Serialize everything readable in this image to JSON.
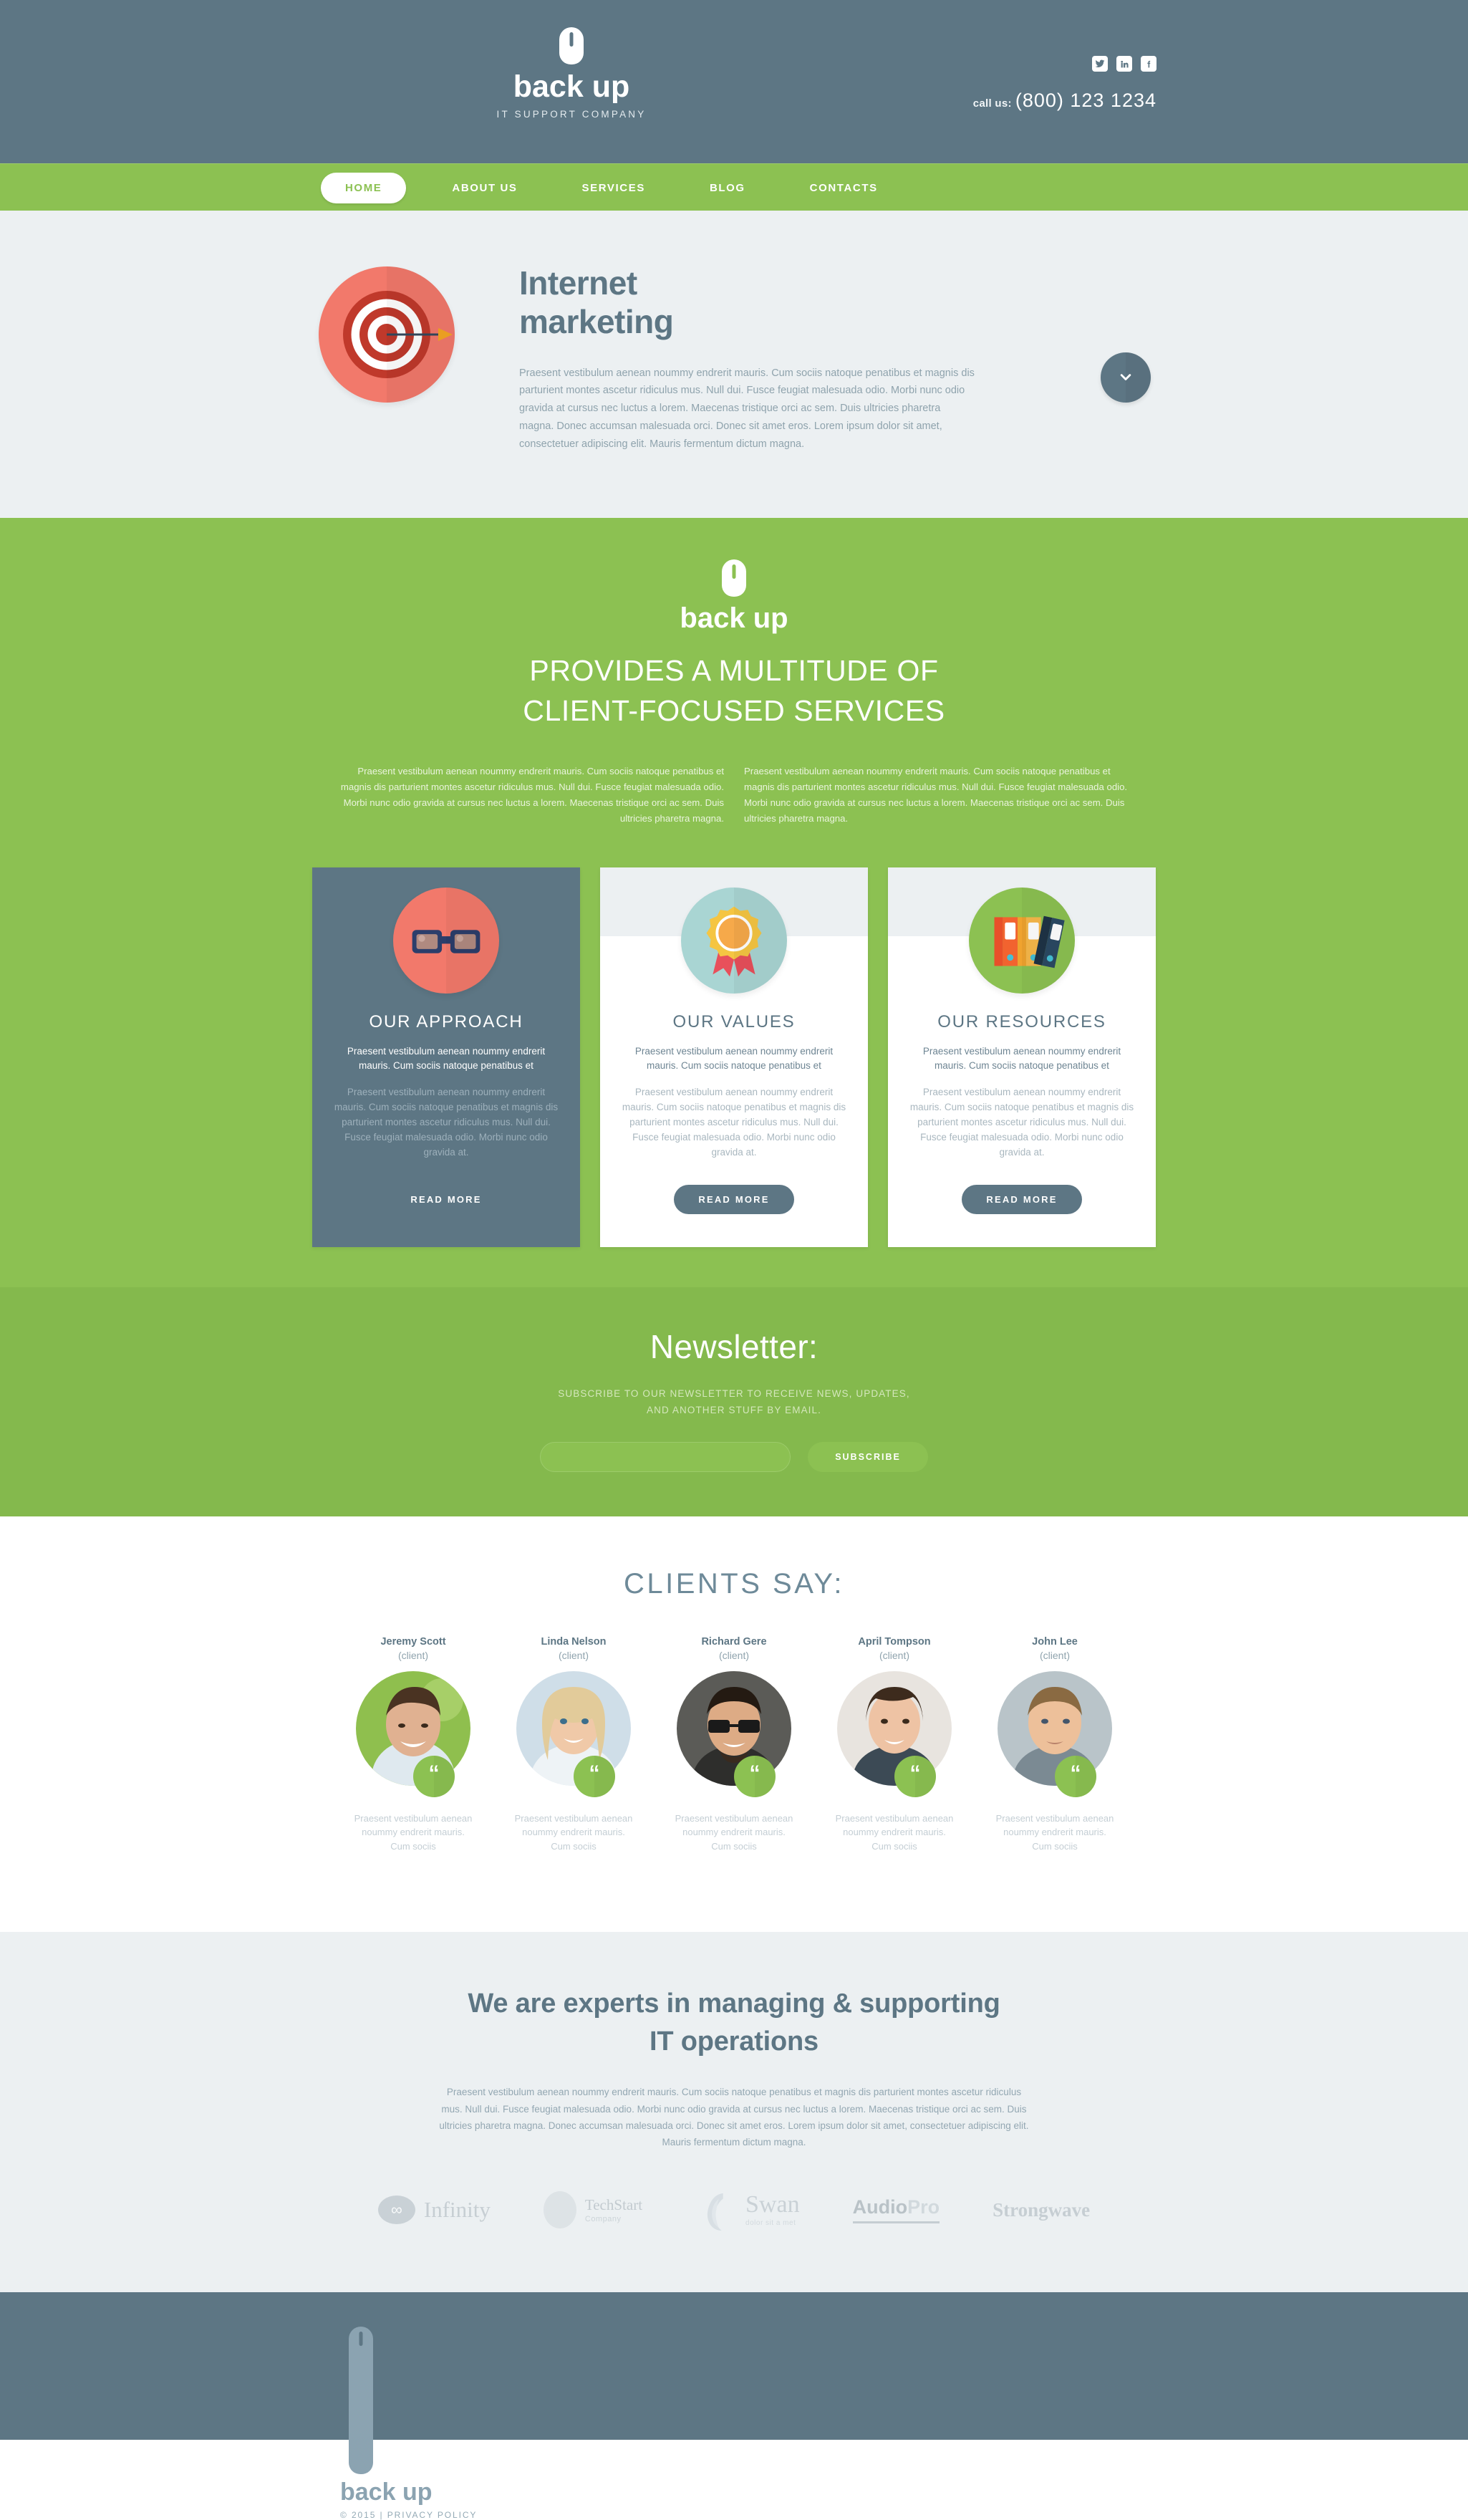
{
  "header": {
    "logo_name": "back up",
    "logo_tagline": "IT SUPPORT COMPANY",
    "socials": [
      {
        "name": "twitter-icon",
        "label": "Twitter"
      },
      {
        "name": "linkedin-icon",
        "label": "LinkedIn"
      },
      {
        "name": "facebook-icon",
        "label": "Facebook"
      }
    ],
    "call_label": "call us:",
    "phone": "(800) 123 1234"
  },
  "nav": {
    "items": [
      {
        "label": "HOME",
        "active": true
      },
      {
        "label": "ABOUT US",
        "active": false
      },
      {
        "label": "SERVICES",
        "active": false
      },
      {
        "label": "BLOG",
        "active": false
      },
      {
        "label": "CONTACTS",
        "active": false
      }
    ]
  },
  "hero": {
    "icon": "target-with-arrow-icon",
    "title_line1": "Internet",
    "title_line2": "marketing",
    "paragraph": "Praesent vestibulum aenean noummy endrerit mauris. Cum sociis natoque penatibus et magnis dis parturient montes ascetur ridiculus mus. Null dui. Fusce feugiat malesuada odio. Morbi nunc odio gravida at cursus nec luctus a lorem. Maecenas tristique orci ac sem. Duis ultricies pharetra magna. Donec accumsan malesuada orci. Donec sit amet eros. Lorem ipsum dolor sit amet, consectetuer adipiscing elit. Mauris fermentum dictum magna.",
    "scroll_icon": "chevron-down-icon"
  },
  "services": {
    "brand_name": "back up",
    "heading_line1": "PROVIDES A MULTITUDE OF",
    "heading_line2": "CLIENT-FOCUSED SERVICES",
    "intro_left": "Praesent vestibulum aenean noummy endrerit mauris. Cum sociis natoque penatibus et magnis dis parturient montes ascetur ridiculus mus. Null dui. Fusce feugiat malesuada odio. Morbi nunc odio gravida at cursus nec luctus a lorem. Maecenas tristique orci ac sem. Duis ultricies pharetra magna.",
    "intro_right": "Praesent vestibulum aenean noummy endrerit mauris. Cum sociis natoque penatibus et magnis dis parturient montes ascetur ridiculus mus. Null dui. Fusce feugiat malesuada odio. Morbi nunc odio gravida at cursus nec luctus a lorem. Maecenas tristique orci ac sem. Duis ultricies pharetra magna.",
    "cards": [
      {
        "icon": "glasses-icon",
        "icon_color": "#f2796b",
        "title": "OUR APPROACH",
        "lead": "Praesent vestibulum aenean noummy endrerit mauris. Cum sociis natoque penatibus et",
        "desc": "Praesent vestibulum aenean noummy endrerit mauris. Cum sociis natoque penatibus et magnis dis parturient montes ascetur ridiculus mus. Null dui. Fusce feugiat malesuada odio. Morbi nunc odio gravida at.",
        "button": "READ MORE"
      },
      {
        "icon": "award-medal-icon",
        "icon_color": "#a9d5d3",
        "title": "OUR VALUES",
        "lead": "Praesent vestibulum aenean noummy endrerit mauris. Cum sociis natoque penatibus et",
        "desc": "Praesent vestibulum aenean noummy endrerit mauris. Cum sociis natoque penatibus et magnis dis parturient montes ascetur ridiculus mus. Null dui. Fusce feugiat malesuada odio. Morbi nunc odio gravida at.",
        "button": "READ MORE"
      },
      {
        "icon": "binders-icon",
        "icon_color": "#8cc152",
        "title": "OUR RESOURCES",
        "lead": "Praesent vestibulum aenean noummy endrerit mauris. Cum sociis natoque penatibus et",
        "desc": "Praesent vestibulum aenean noummy endrerit mauris. Cum sociis natoque penatibus et magnis dis parturient montes ascetur ridiculus mus. Null dui. Fusce feugiat malesuada odio. Morbi nunc odio gravida at.",
        "button": "READ MORE"
      }
    ]
  },
  "newsletter": {
    "title": "Newsletter:",
    "subtitle_line1": "SUBSCRIBE TO OUR NEWSLETTER TO RECEIVE NEWS, UPDATES,",
    "subtitle_line2": "AND ANOTHER STUFF BY EMAIL.",
    "input_value": "",
    "input_placeholder": "",
    "button": "SUBSCRIBE"
  },
  "clients": {
    "title": "CLIENTS SAY:",
    "quote_glyph": "“",
    "items": [
      {
        "name": "Jeremy Scott",
        "role": "(client)",
        "text": "Praesent vestibulum aenean noummy endrerit mauris. Cum sociis"
      },
      {
        "name": "Linda Nelson",
        "role": "(client)",
        "text": "Praesent vestibulum aenean noummy endrerit mauris. Cum sociis"
      },
      {
        "name": "Richard Gere",
        "role": "(client)",
        "text": "Praesent vestibulum aenean noummy endrerit mauris. Cum sociis"
      },
      {
        "name": "April Tompson",
        "role": "(client)",
        "text": "Praesent vestibulum aenean noummy endrerit mauris. Cum sociis"
      },
      {
        "name": "John Lee",
        "role": "(client)",
        "text": "Praesent vestibulum aenean noummy endrerit mauris. Cum sociis"
      }
    ]
  },
  "experts": {
    "title_line1": "We are experts in managing & supporting",
    "title_line2": "IT operations",
    "paragraph": "Praesent vestibulum aenean noummy endrerit mauris. Cum sociis natoque penatibus et magnis dis parturient montes ascetur ridiculus mus. Null dui. Fusce feugiat malesuada odio. Morbi nunc odio gravida at cursus nec luctus a lorem. Maecenas tristique orci ac sem. Duis ultricies pharetra magna. Donec accumsan malesuada orci. Donec sit amet eros. Lorem ipsum dolor sit amet, consectetuer adipiscing elit. Mauris fermentum dictum magna.",
    "logos": [
      {
        "name": "Infinity",
        "mark": "infinity-icon",
        "sub": ""
      },
      {
        "name": "TechStart",
        "mark": "oval-icon",
        "sub": "Company"
      },
      {
        "name": "Swan",
        "mark": "swan-icon",
        "sub": "dolor sit a met"
      },
      {
        "name": "AudioPro",
        "mark": "",
        "sub": ""
      },
      {
        "name": "Strongwave",
        "mark": "",
        "sub": ""
      }
    ]
  },
  "footer": {
    "logo_name": "back up",
    "copyright": "© 2015 | ",
    "privacy": "PRIVACY POLICY"
  },
  "colors": {
    "brand_green": "#8cc152",
    "brand_slate": "#5d7684",
    "light_grey": "#ecf0f2",
    "coral": "#f2796b",
    "teal": "#a9d5d3"
  }
}
